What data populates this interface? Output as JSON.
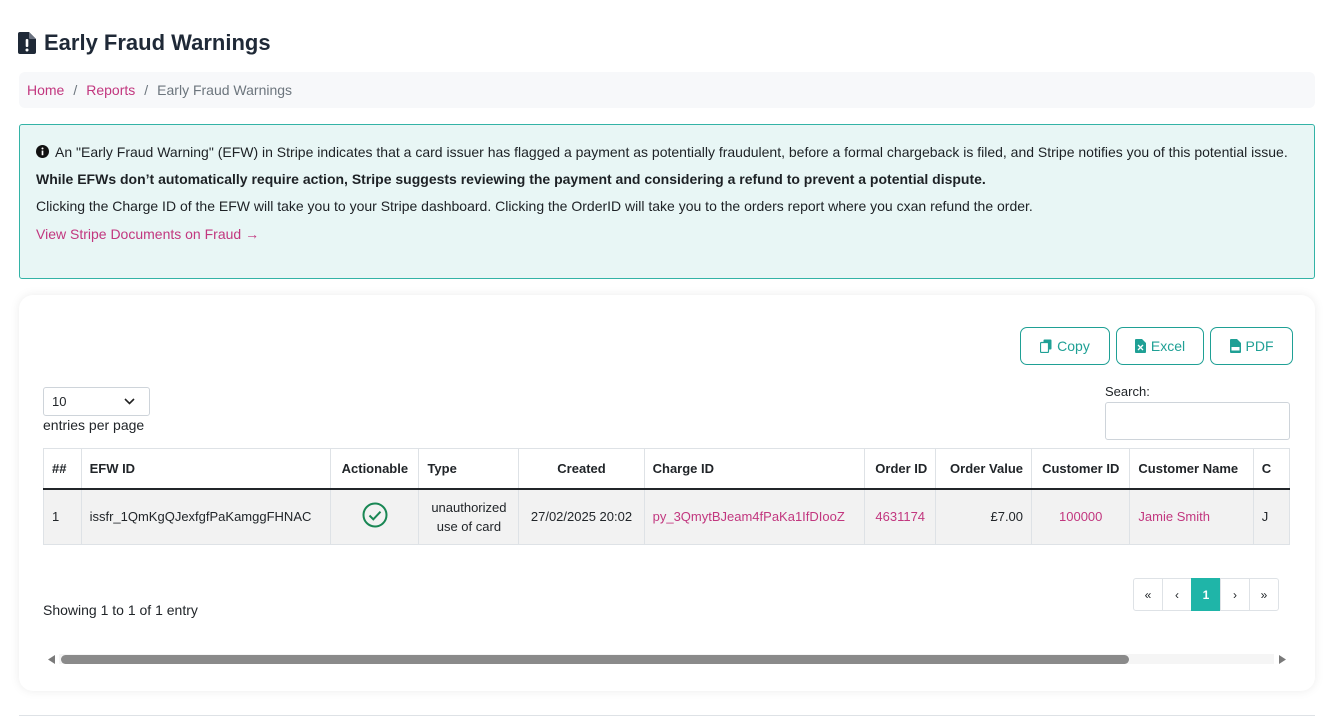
{
  "header": {
    "title": "Early Fraud Warnings",
    "icon": "file-exclamation-icon"
  },
  "breadcrumb": {
    "home": "Home",
    "reports": "Reports",
    "current": "Early Fraud Warnings",
    "separator": "/"
  },
  "alert": {
    "line1": "An \"Early Fraud Warning\" (EFW) in Stripe indicates that a card issuer has flagged a payment as potentially fraudulent, before a formal chargeback is filed, and Stripe notifies you of this potential issue.",
    "line2": "While EFWs don’t automatically require action, Stripe suggests reviewing the payment and considering a refund to prevent a potential dispute.",
    "line3": "Clicking the Charge ID of the EFW will take you to your Stripe dashboard. Clicking the OrderID will take you to the orders report where you cxan refund the order.",
    "link": "View Stripe Documents on Fraud",
    "link_arrow": "→"
  },
  "toolbar": {
    "copy": "Copy",
    "excel": "Excel",
    "pdf": "PDF"
  },
  "length": {
    "value": "10",
    "label": "entries per page"
  },
  "search": {
    "label": "Search:",
    "value": ""
  },
  "table": {
    "columns": [
      "##",
      "EFW ID",
      "Actionable",
      "Type",
      "Created",
      "Charge ID",
      "Order ID",
      "Order Value",
      "Customer ID",
      "Customer Name",
      "C"
    ],
    "rows": [
      {
        "num": "1",
        "efw_id": "issfr_1QmKgQJexfgfPaKamggFHNAC",
        "actionable": true,
        "type": "unauthorized use of card",
        "created": "27/02/2025 20:02",
        "charge_id": "py_3QmytBJeam4fPaKa1IfDIooZ",
        "order_id": "4631174",
        "order_value": "£7.00",
        "customer_id": "100000",
        "customer_name": "Jamie Smith",
        "next": "J"
      }
    ]
  },
  "info": "Showing 1 to 1 of 1 entry",
  "pagination": {
    "first": "«",
    "prev": "‹",
    "current": "1",
    "next": "›",
    "last": "»"
  },
  "colors": {
    "accent": "#1fb5a8",
    "link": "#c2377f",
    "alert_bg": "#e8f6f5",
    "alert_border": "#33b3a6",
    "success": "#198754"
  }
}
